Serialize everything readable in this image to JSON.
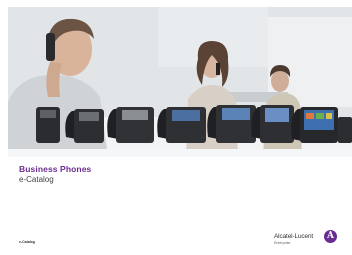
{
  "document": {
    "title": "Business Phones",
    "subtitle": "e-Catalog",
    "footer_label": "e-Catalog"
  },
  "brand": {
    "name": "Alcatel-Lucent",
    "tagline": "Enterprise",
    "logo_letter": "A",
    "accent_color": "#6a2c91"
  },
  "hero": {
    "scene": "office workers on calls with a row of desk phones",
    "phone_count": 8
  }
}
